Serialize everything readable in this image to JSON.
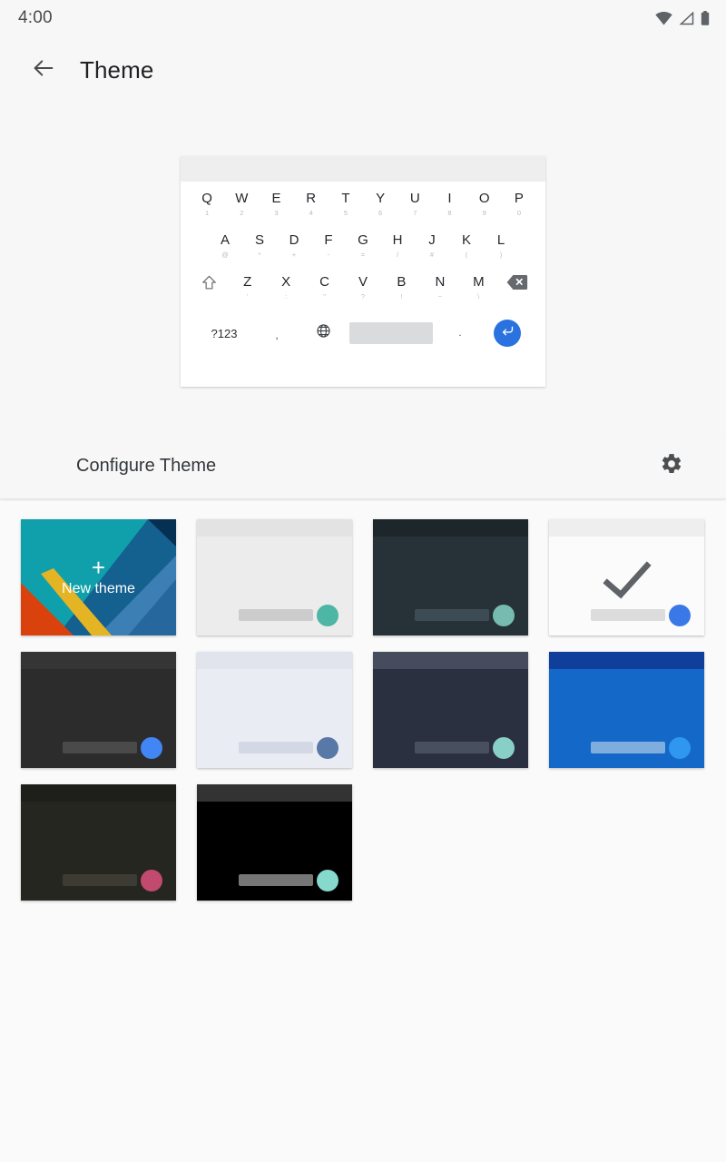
{
  "status_bar": {
    "clock": "4:00",
    "icons": [
      "wifi-icon",
      "signal-icon",
      "battery-icon"
    ]
  },
  "app_bar": {
    "back_icon": "arrow-back-icon",
    "title": "Theme"
  },
  "keyboard_preview": {
    "name": "keyboard-preview",
    "row1": [
      {
        "main": "Q",
        "sub": "1"
      },
      {
        "main": "W",
        "sub": "2"
      },
      {
        "main": "E",
        "sub": "3"
      },
      {
        "main": "R",
        "sub": "4"
      },
      {
        "main": "T",
        "sub": "5"
      },
      {
        "main": "Y",
        "sub": "6"
      },
      {
        "main": "U",
        "sub": "7"
      },
      {
        "main": "I",
        "sub": "8"
      },
      {
        "main": "O",
        "sub": "9"
      },
      {
        "main": "P",
        "sub": "0"
      }
    ],
    "row2": [
      {
        "main": "A",
        "sub": "@"
      },
      {
        "main": "S",
        "sub": "*"
      },
      {
        "main": "D",
        "sub": "+"
      },
      {
        "main": "F",
        "sub": "-"
      },
      {
        "main": "G",
        "sub": "="
      },
      {
        "main": "H",
        "sub": "/"
      },
      {
        "main": "J",
        "sub": "#"
      },
      {
        "main": "K",
        "sub": "("
      },
      {
        "main": "L",
        "sub": ")"
      }
    ],
    "row3": [
      {
        "main": "Z",
        "sub": "'"
      },
      {
        "main": "X",
        "sub": ":"
      },
      {
        "main": "C",
        "sub": "\""
      },
      {
        "main": "V",
        "sub": "?"
      },
      {
        "main": "B",
        "sub": "!"
      },
      {
        "main": "N",
        "sub": "~"
      },
      {
        "main": "M",
        "sub": "\\"
      }
    ],
    "shift_icon": "shift-icon",
    "backspace_icon": "backspace-icon",
    "row4": {
      "symbols_label": "?123",
      "comma_label": ",",
      "globe_icon": "globe-icon",
      "space_label": "",
      "period_label": ".",
      "enter_icon": "enter-icon",
      "enter_color": "#2a72e0"
    }
  },
  "configure": {
    "label": "Configure Theme",
    "gear_icon": "gear-icon"
  },
  "theme_grid": {
    "tiles": [
      {
        "name": "new-theme",
        "kind": "new",
        "plus": "+",
        "label": "New theme",
        "colors": {
          "teal": "#10a0ab",
          "blue_dark": "#0d4d80",
          "blue_mid": "#14608f",
          "blue_light": "#3b7fb5",
          "navy": "#063052",
          "orange": "#d9410d",
          "yellow": "#e5b424"
        },
        "selected": false
      },
      {
        "name": "theme-light-gray",
        "kind": "theme",
        "bg": "#ececec",
        "topbar": "#e3e3e3",
        "space": "#cccccc",
        "dot": "#4db6a4",
        "selected": false
      },
      {
        "name": "theme-dark-slate",
        "kind": "theme",
        "bg": "#263238",
        "topbar": "#1c262b",
        "space": "#3d4c54",
        "dot": "#77bbb0",
        "selected": false
      },
      {
        "name": "theme-material-light-selected",
        "kind": "theme",
        "bg": "#fbfbfb",
        "topbar": "#eeeeee",
        "space": "#dcdcdc",
        "dot": "#3b78e7",
        "selected": true,
        "check_color": "#5f6368"
      },
      {
        "name": "theme-dark-gray",
        "kind": "theme",
        "bg": "#2c2c2c",
        "topbar": "#353535",
        "space": "#4a4a4a",
        "dot": "#4285f4",
        "selected": false
      },
      {
        "name": "theme-light-lavender",
        "kind": "theme",
        "bg": "#eaecf3",
        "topbar": "#e1e4ec",
        "space": "#d3d8e4",
        "dot": "#5878a8",
        "selected": false
      },
      {
        "name": "theme-dark-indigo",
        "kind": "theme",
        "bg": "#2b3040",
        "topbar": "#454c5e",
        "space": "#485060",
        "dot": "#88cfc7",
        "selected": false
      },
      {
        "name": "theme-blue",
        "kind": "theme",
        "bg": "#1468c8",
        "topbar": "#0f3f9b",
        "space": "#7eadde",
        "dot": "#2f97f0",
        "selected": false
      },
      {
        "name": "theme-dark-olive",
        "kind": "theme",
        "bg": "#262621",
        "topbar": "#1e1e1a",
        "space": "#3c3c35",
        "dot": "#c24a6e",
        "selected": false
      },
      {
        "name": "theme-black",
        "kind": "theme",
        "bg": "#000000",
        "topbar": "#333333",
        "space": "#767676",
        "dot": "#86d9cc",
        "selected": false
      }
    ]
  }
}
